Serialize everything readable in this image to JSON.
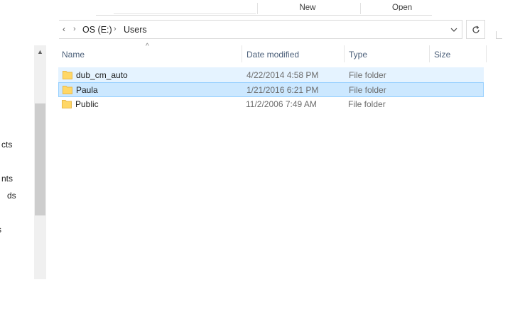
{
  "ribbon": {
    "new_label": "New",
    "open_label": "Open"
  },
  "address": {
    "overflow": "‹",
    "crumbs": [
      "OS (E:)",
      "Users"
    ]
  },
  "nav": {
    "items": [
      "cts",
      "nts",
      "ds",
      "s"
    ]
  },
  "columns": {
    "name": "Name",
    "date": "Date modified",
    "type": "Type",
    "size": "Size"
  },
  "files": [
    {
      "name": "dub_cm_auto",
      "date": "4/22/2014 4:58 PM",
      "type": "File folder",
      "state": "hover"
    },
    {
      "name": "Paula",
      "date": "1/21/2016 6:21 PM",
      "type": "File folder",
      "state": "selected"
    },
    {
      "name": "Public",
      "date": "11/2/2006 7:49 AM",
      "type": "File folder",
      "state": "normal"
    }
  ],
  "colors": {
    "folder": "#ffd766",
    "folder_tab": "#e8b84a",
    "hover_row": "#e5f3ff",
    "selected_row": "#cce8ff",
    "selected_border": "#99d1ff"
  }
}
